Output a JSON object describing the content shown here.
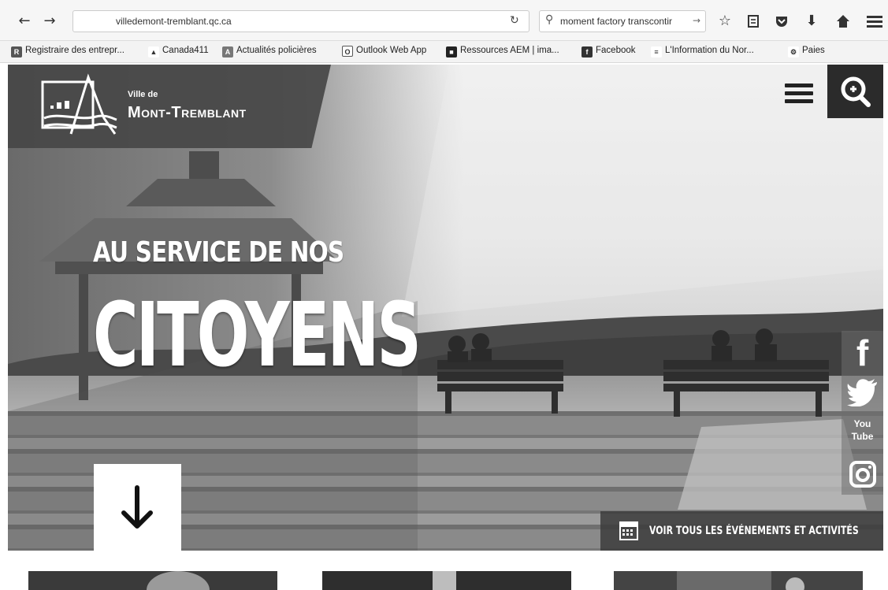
{
  "browser": {
    "url": "villedemont-tremblant.qc.ca",
    "search_query": "moment factory transcontir",
    "bookmarks": [
      {
        "label": "Registraire des entrepr...",
        "icon": "registry-icon"
      },
      {
        "label": "Canada411",
        "icon": "canada411-icon"
      },
      {
        "label": "Actualités policières",
        "icon": "news-icon"
      },
      {
        "label": "Outlook Web App",
        "icon": "outlook-icon"
      },
      {
        "label": "Ressources AEM | ima...",
        "icon": "aem-icon"
      },
      {
        "label": "Facebook",
        "icon": "facebook-icon"
      },
      {
        "label": "L'Information du Nor...",
        "icon": "news-icon"
      },
      {
        "label": "Paies",
        "icon": "payroll-icon"
      }
    ]
  },
  "site": {
    "logo_small": "Ville de",
    "logo_big": "Mont-Tremblant",
    "headline_top": "AU SERVICE DE NOS",
    "headline_main": "CITOYENS",
    "events_label": "VOIR TOUS LES ÉVÉNEMENTS ET ACTIVITÉS",
    "social": [
      {
        "name": "facebook",
        "glyph": "f"
      },
      {
        "name": "twitter",
        "glyph": ""
      },
      {
        "name": "youtube",
        "glyph": "You Tube"
      },
      {
        "name": "instagram",
        "glyph": ""
      }
    ]
  },
  "colors": {
    "dark_panel": "#2b2b2b",
    "overlay": "#464646",
    "white": "#ffffff"
  }
}
